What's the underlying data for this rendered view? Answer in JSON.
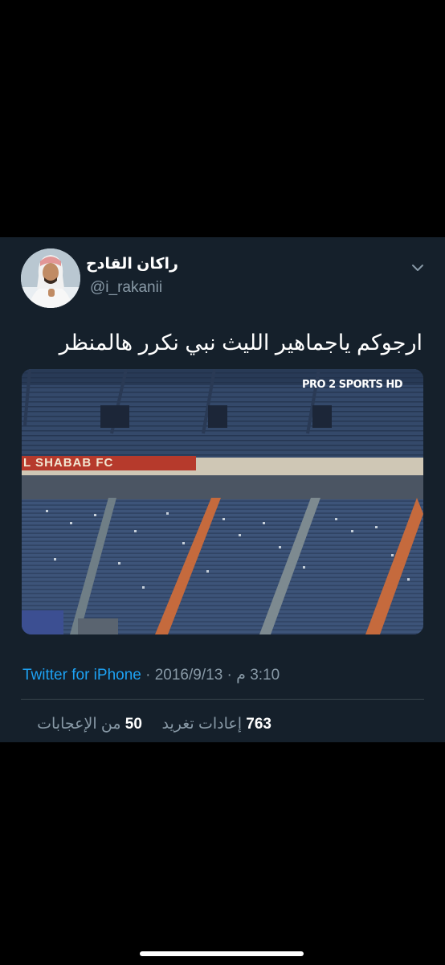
{
  "tweet": {
    "display_name": "راكان القادح",
    "handle": "@i_rakanii",
    "text": "ارجوكم ياجماهير الليث نبي نكرر هالمنظر",
    "media": {
      "banner_text": "L SHABAB FC",
      "watermark": "PRO 2 SPORTS HD"
    },
    "meta": {
      "source": "Twitter for iPhone",
      "separator": "·",
      "date": "2016/9/13",
      "time": "3:10 م"
    },
    "stats": {
      "likes_count": "50",
      "likes_label": "من الإعجابات",
      "retweets_count": "763",
      "retweets_label": "إعادات تغريد"
    }
  },
  "icons": {
    "more_menu": "chevron-down-icon"
  },
  "colors": {
    "background": "#000000",
    "card": "#15202b",
    "link": "#1da1f2",
    "secondary_text": "#8899a6",
    "divider": "#38444d"
  }
}
